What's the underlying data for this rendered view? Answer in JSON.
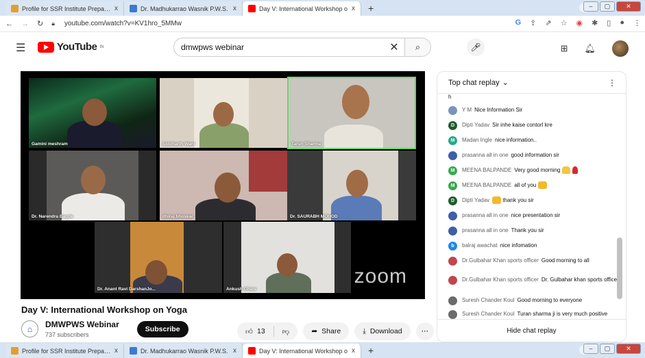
{
  "browser": {
    "tabs": [
      {
        "title": "Profile for SSR Institute Prepared",
        "close": "x",
        "icon": "profile-icon",
        "color": "#e0a030"
      },
      {
        "title": "Dr. Madhukarrao Wasnik P.W.S.",
        "close": "x",
        "icon": "site-icon",
        "color": "#3b7bd1"
      },
      {
        "title": "Day V: International Workshop o",
        "close": "x",
        "icon": "youtube-icon",
        "color": "#ff0000"
      }
    ],
    "new_tab": "+",
    "url": "youtube.com/watch?v=KV1hro_5MMw"
  },
  "youtube": {
    "logo_text": "YouTube",
    "region": "IN",
    "search_value": "dmwpws webinar",
    "video_title": "Day V: International Workshop on Yoga",
    "channel_name": "DMWPWS Webinar",
    "subscribers": "737 subscribers",
    "subscribe_label": "Subscribe",
    "likes": "13",
    "share_label": "Share",
    "download_label": "Download",
    "zoom_watermark": "zoom"
  },
  "participants": [
    "Gamini meshram",
    "Siddharth Wani",
    "Tarun Sharma",
    "Dr. Narendra Bagde",
    "dhiraj bhoskar",
    "Dr. SAURABH MOHOD",
    "Dr. Anant Ravi DarshanJo...",
    "Ankush Ghate"
  ],
  "chat": {
    "header": "Top chat replay",
    "partial": "h",
    "footer": "Hide chat replay",
    "messages": [
      {
        "author": "Y M",
        "text": "Nice Information Sir",
        "initial": "",
        "color": "#7b95b8"
      },
      {
        "author": "Dipti Yadav",
        "text": "Sir inhe kaise contorl kre",
        "initial": "D",
        "color": "#1f5c2b"
      },
      {
        "author": "Madan Ingle",
        "text": "nice information..",
        "initial": "M",
        "color": "#27a88a"
      },
      {
        "author": "prasanna all in one",
        "text": "good information sir",
        "initial": "",
        "color": "#3d5fa8"
      },
      {
        "author": "MEENA BALPANDE",
        "text": "Very good morning",
        "initial": "M",
        "color": "#39a852"
      },
      {
        "author": "MEENA BALPANDE",
        "text": "all of you",
        "initial": "M",
        "color": "#39a852"
      },
      {
        "author": "Dipti Yadav",
        "text": "thank you sir",
        "initial": "D",
        "color": "#1f5c2b"
      },
      {
        "author": "prasanna all in one",
        "text": "nice presentation sir",
        "initial": "",
        "color": "#3d5fa8"
      },
      {
        "author": "prasanna all in one",
        "text": "Thank you sir",
        "initial": "",
        "color": "#3d5fa8"
      },
      {
        "author": "balraj awachat",
        "text": "nice infomation",
        "initial": "b",
        "color": "#1e88e5"
      },
      {
        "author": "Dr.Gulbahar Khan sports officer",
        "text": "Good morning to all",
        "initial": "",
        "color": "#c2464c"
      },
      {
        "author": "Dr.Gulbahar Khan sports officer",
        "text": "Dr. Gulbahar khan sports officer",
        "initial": "",
        "color": "#c2464c"
      },
      {
        "author": "Suresh Chander Koul",
        "text": "Good morning to everyone",
        "initial": "",
        "color": "#6b6b6b"
      },
      {
        "author": "Suresh Chander Koul",
        "text": "Turan sharma ji is very much positive thinker",
        "initial": "",
        "color": "#6b6b6b"
      }
    ]
  }
}
